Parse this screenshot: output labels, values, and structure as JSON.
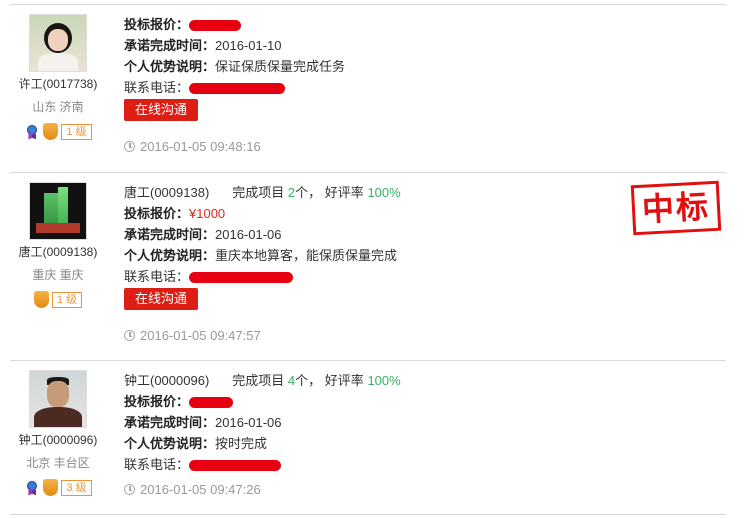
{
  "bids": [
    {
      "username": "许工(0017738)",
      "location": "山东 济南",
      "level": "1 级",
      "badges": [
        "medal-icon",
        "shield-icon"
      ],
      "header": null,
      "price_label": "投标报价：",
      "price_value": "",
      "deadline_label": "承诺完成时间：",
      "deadline_value": "2016-01-10",
      "advantage_label": "个人优势说明：",
      "advantage_value": "保证保质保量完成任务",
      "phone_label": "联系电话：",
      "contact_button": "在线沟通",
      "timestamp": "2016-01-05 09:48:16"
    },
    {
      "username": "唐工(0009138)",
      "location": "重庆 重庆",
      "level": "1 级",
      "badges": [
        "shield-icon"
      ],
      "header": {
        "name": "唐工(0009138)",
        "completed_label": "完成项目",
        "completed_count": "2",
        "completed_unit": "个，",
        "rating_label": "好评率",
        "rating_value": "100%"
      },
      "price_label": "投标报价：",
      "price_value": "¥1000",
      "deadline_label": "承诺完成时间：",
      "deadline_value": "2016-01-06",
      "advantage_label": "个人优势说明：",
      "advantage_value": "重庆本地算客，能保质保量完成",
      "phone_label": "联系电话：",
      "contact_button": "在线沟通",
      "timestamp": "2016-01-05 09:47:57",
      "stamp": "中标"
    },
    {
      "username": "钟工(0000096)",
      "location": "北京 丰台区",
      "level": "3 级",
      "badges": [
        "medal-icon",
        "shield-icon"
      ],
      "header": {
        "name": "钟工(0000096)",
        "completed_label": "完成项目",
        "completed_count": "4",
        "completed_unit": "个，",
        "rating_label": "好评率",
        "rating_value": "100%"
      },
      "price_label": "投标报价：",
      "price_value": "",
      "deadline_label": "承诺完成时间：",
      "deadline_value": "2016-01-06",
      "advantage_label": "个人优势说明：",
      "advantage_value": "按时完成",
      "phone_label": "联系电话：",
      "timestamp": "2016-01-05 09:47:26"
    }
  ]
}
